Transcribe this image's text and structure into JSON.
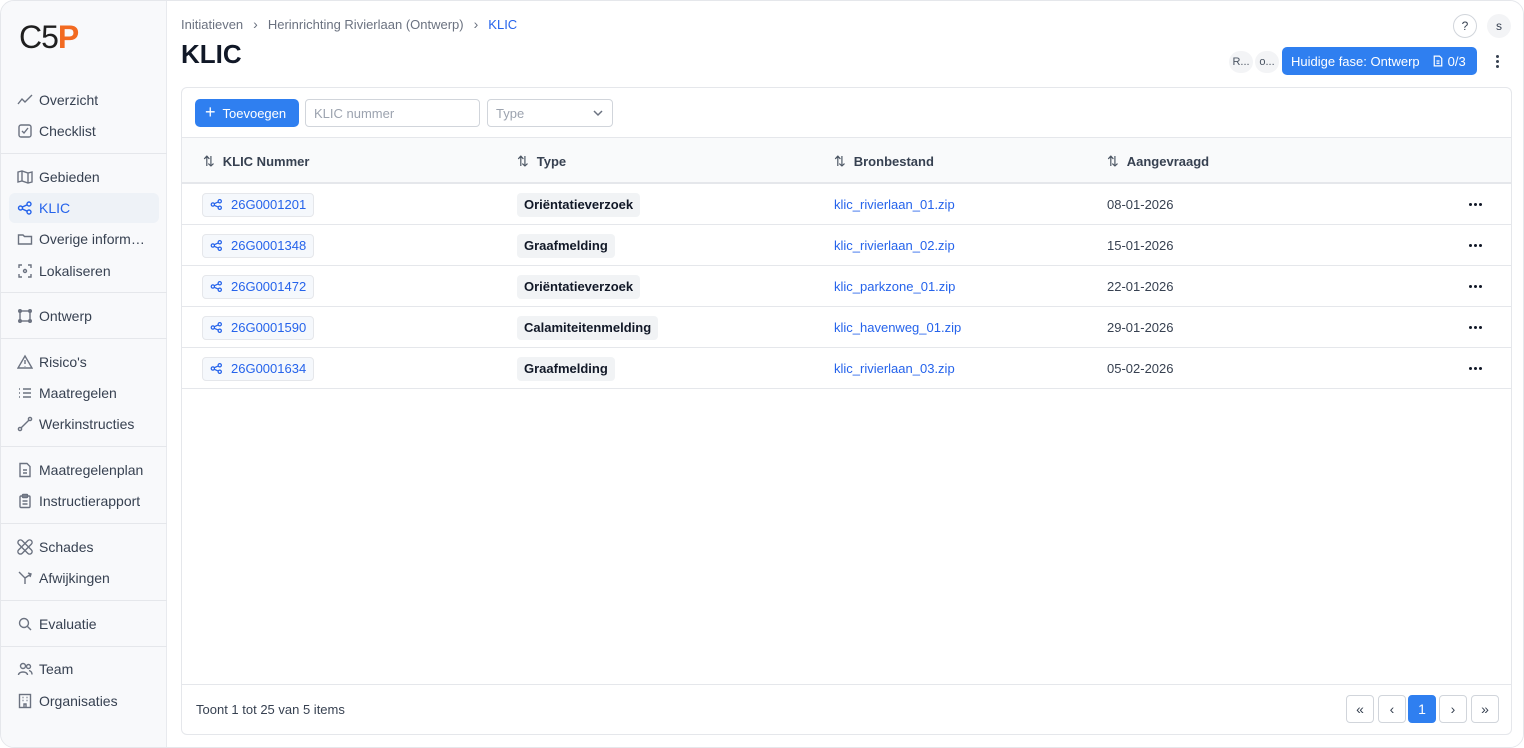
{
  "logo": {
    "text_a": "C5",
    "text_b": "P"
  },
  "sidebar": {
    "items": [
      {
        "label": "Overzicht",
        "icon": "trend-icon"
      },
      {
        "label": "Checklist",
        "icon": "checkbox-icon"
      },
      {
        "label": "Gebieden",
        "icon": "map-icon"
      },
      {
        "label": "KLIC",
        "icon": "share-nodes-icon"
      },
      {
        "label": "Overige informatie",
        "icon": "folder-icon"
      },
      {
        "label": "Lokaliseren",
        "icon": "locate-icon"
      },
      {
        "label": "Ontwerp",
        "icon": "frame-icon"
      },
      {
        "label": "Risico's",
        "icon": "warning-triangle-icon"
      },
      {
        "label": "Maatregelen",
        "icon": "list-icon"
      },
      {
        "label": "Werkinstructies",
        "icon": "route-icon"
      },
      {
        "label": "Maatregelenplan",
        "icon": "document-icon"
      },
      {
        "label": "Instructierapport",
        "icon": "clipboard-icon"
      },
      {
        "label": "Schades",
        "icon": "bandage-icon"
      },
      {
        "label": "Afwijkingen",
        "icon": "diverge-icon"
      },
      {
        "label": "Evaluatie",
        "icon": "magnifier-icon"
      },
      {
        "label": "Team",
        "icon": "users-icon"
      },
      {
        "label": "Organisaties",
        "icon": "building-icon"
      }
    ]
  },
  "breadcrumb": {
    "items": [
      "Initiatieven",
      "Herinrichting Rivierlaan (Ontwerp)",
      "KLIC"
    ]
  },
  "page": {
    "title": "KLIC"
  },
  "header": {
    "help_label": "?",
    "user_initial": "s",
    "avatars": [
      "R...",
      "o..."
    ],
    "phase_label": "Huidige fase: Ontwerp",
    "phase_count": "0/3"
  },
  "toolbar": {
    "add_label": "Toevoegen",
    "search_placeholder": "KLIC nummer",
    "type_placeholder": "Type"
  },
  "table": {
    "columns": [
      "KLIC Nummer",
      "Type",
      "Bronbestand",
      "Aangevraagd"
    ],
    "rows": [
      {
        "nummer": "26G0001201",
        "type": "Oriëntatieverzoek",
        "bestand": "klic_rivierlaan_01.zip",
        "datum": "08-01-2026"
      },
      {
        "nummer": "26G0001348",
        "type": "Graafmelding",
        "bestand": "klic_rivierlaan_02.zip",
        "datum": "15-01-2026"
      },
      {
        "nummer": "26G0001472",
        "type": "Oriëntatieverzoek",
        "bestand": "klic_parkzone_01.zip",
        "datum": "22-01-2026"
      },
      {
        "nummer": "26G0001590",
        "type": "Calamiteitenmelding",
        "bestand": "klic_havenweg_01.zip",
        "datum": "29-01-2026"
      },
      {
        "nummer": "26G0001634",
        "type": "Graafmelding",
        "bestand": "klic_rivierlaan_03.zip",
        "datum": "05-02-2026"
      }
    ]
  },
  "footer": {
    "summary": "Toont 1 tot 25 van 5 items",
    "current_page": "1"
  },
  "colors": {
    "accent": "#2f7ff0",
    "brand": "#f26a21"
  }
}
